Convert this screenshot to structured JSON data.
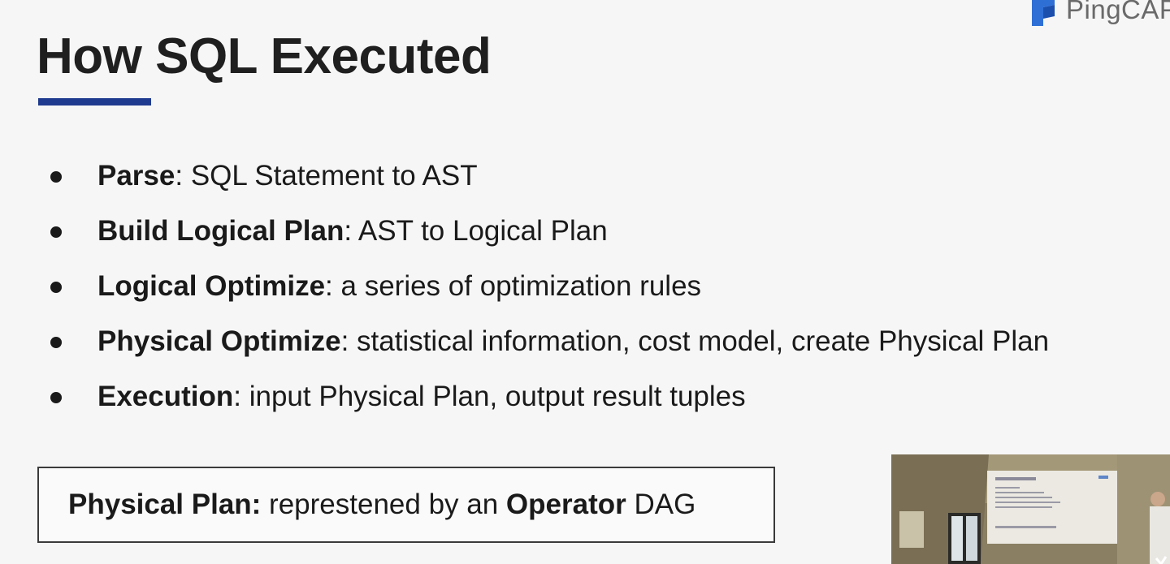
{
  "brand": {
    "logo_text": "PingCAP",
    "accent_color": "#1f3b8f",
    "logo_color": "#2e6fd6"
  },
  "slide": {
    "title": "How SQL Executed",
    "bullets": [
      {
        "term": "Parse",
        "sep": ":",
        "desc": " SQL Statement to AST"
      },
      {
        "term": "Build Logical Plan",
        "sep": ":",
        "desc": " AST to Logical Plan"
      },
      {
        "term": "Logical Optimize",
        "sep": ":",
        "desc": " a series of optimization rules"
      },
      {
        "term": "Physical Optimize",
        "sep": ":",
        "desc": " statistical information, cost model, create Physical Plan"
      },
      {
        "term": "Execution",
        "sep": ":",
        "desc": " input Physical Plan, output result tuples"
      }
    ],
    "note": {
      "label": "Physical Plan:",
      "text_1": " represtened by an ",
      "emphasis": "Operator",
      "text_2": " DAG"
    }
  },
  "camera_inset": {}
}
